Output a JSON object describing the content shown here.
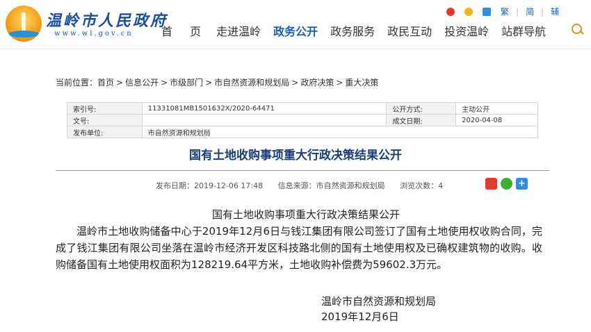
{
  "header": {
    "site_name": "温岭市人民政府",
    "site_url": "www.wl.gov.cn",
    "nav": [
      "首 页",
      "走进温岭",
      "政务公开",
      "政务服务",
      "政民互动",
      "投资温岭",
      "站群导航"
    ],
    "tools": {
      "traditional": "繁",
      "simplified": "简",
      "assist": "辅",
      "sep": "|"
    },
    "colors": {
      "nav_active": "#1a5fb4",
      "brand": "#1a4fa0"
    }
  },
  "breadcrumb": {
    "prefix": "当前位置：",
    "items": [
      "首页",
      "信息公开",
      "市级部门",
      "市自然资源和规划局",
      "政府决策",
      "重大决策"
    ],
    "sep": ">"
  },
  "meta": {
    "index_label": "索引号:",
    "index_value": "11331081MB1501632X/2020-64471",
    "method_label": "公开方式:",
    "method_value": "主动公开",
    "doc_label": "文号:",
    "doc_value": "",
    "date_label": "成文日期:",
    "date_value": "2020-04-08",
    "publisher_label": "发布单位:",
    "publisher_value": "市自然资源和规划局"
  },
  "article": {
    "title": "国有土地收购事项重大行政决策结果公开",
    "publish_time": "发布日期：2019-12-06 17:48",
    "source": "信息来源：市自然资源和规划局",
    "views": "浏览次数：4",
    "content_title": "国有土地收购事项重大行政决策结果公开",
    "paragraph": "温岭市土地收购储备中心于2019年12月6日与钱江集团有限公司签订了国有土地使用权收购合同，完成了钱江集团有限公司坐落在温岭市经济开发区科技路北侧的国有土地使用权及已确权建筑物的收购。收购储备国有土地使用权面积为128219.64平方米，土地收购补偿费为59602.3万元。",
    "signature": "温岭市自然资源和规划局",
    "sign_date": "2019年12月6日"
  }
}
